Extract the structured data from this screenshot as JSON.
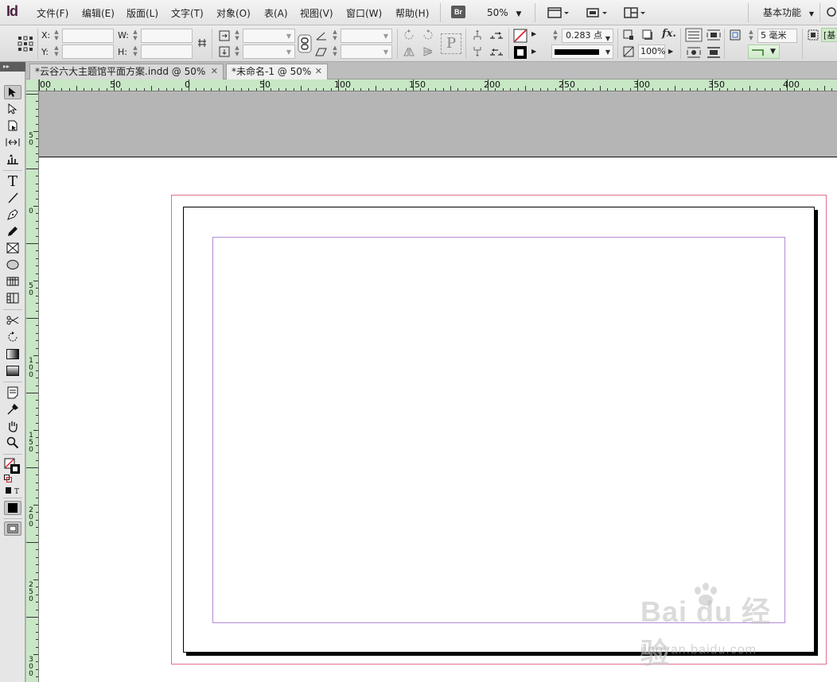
{
  "app": {
    "logo": "Id"
  },
  "menu": {
    "items": [
      "文件(F)",
      "编辑(E)",
      "版面(L)",
      "文字(T)",
      "对象(O)",
      "表(A)",
      "视图(V)",
      "窗口(W)",
      "帮助(H)"
    ],
    "bridge_badge": "Br",
    "zoom": "50%",
    "workspace": "基本功能"
  },
  "control_panel": {
    "x_label": "X:",
    "y_label": "Y:",
    "w_label": "W:",
    "h_label": "H:",
    "stroke_weight": "0.283 点",
    "scale_percent": "100%",
    "offset_value": "5 毫米",
    "right_edge_text": "[基"
  },
  "tabs": [
    {
      "label": "*云谷六大主题馆平面方案.indd @ 50%",
      "active": false
    },
    {
      "label": "*未命名-1 @ 50%",
      "active": true
    }
  ],
  "ruler_h": [
    "00",
    "50",
    "0",
    "50",
    "100",
    "150",
    "200",
    "250",
    "300",
    "350",
    "400"
  ],
  "ruler_v": [
    "50",
    "0",
    "50",
    "100",
    "150",
    "200",
    "250",
    "300"
  ],
  "watermark": {
    "brand": "Bai du 经验",
    "url": "jingyan.baidu.com"
  }
}
